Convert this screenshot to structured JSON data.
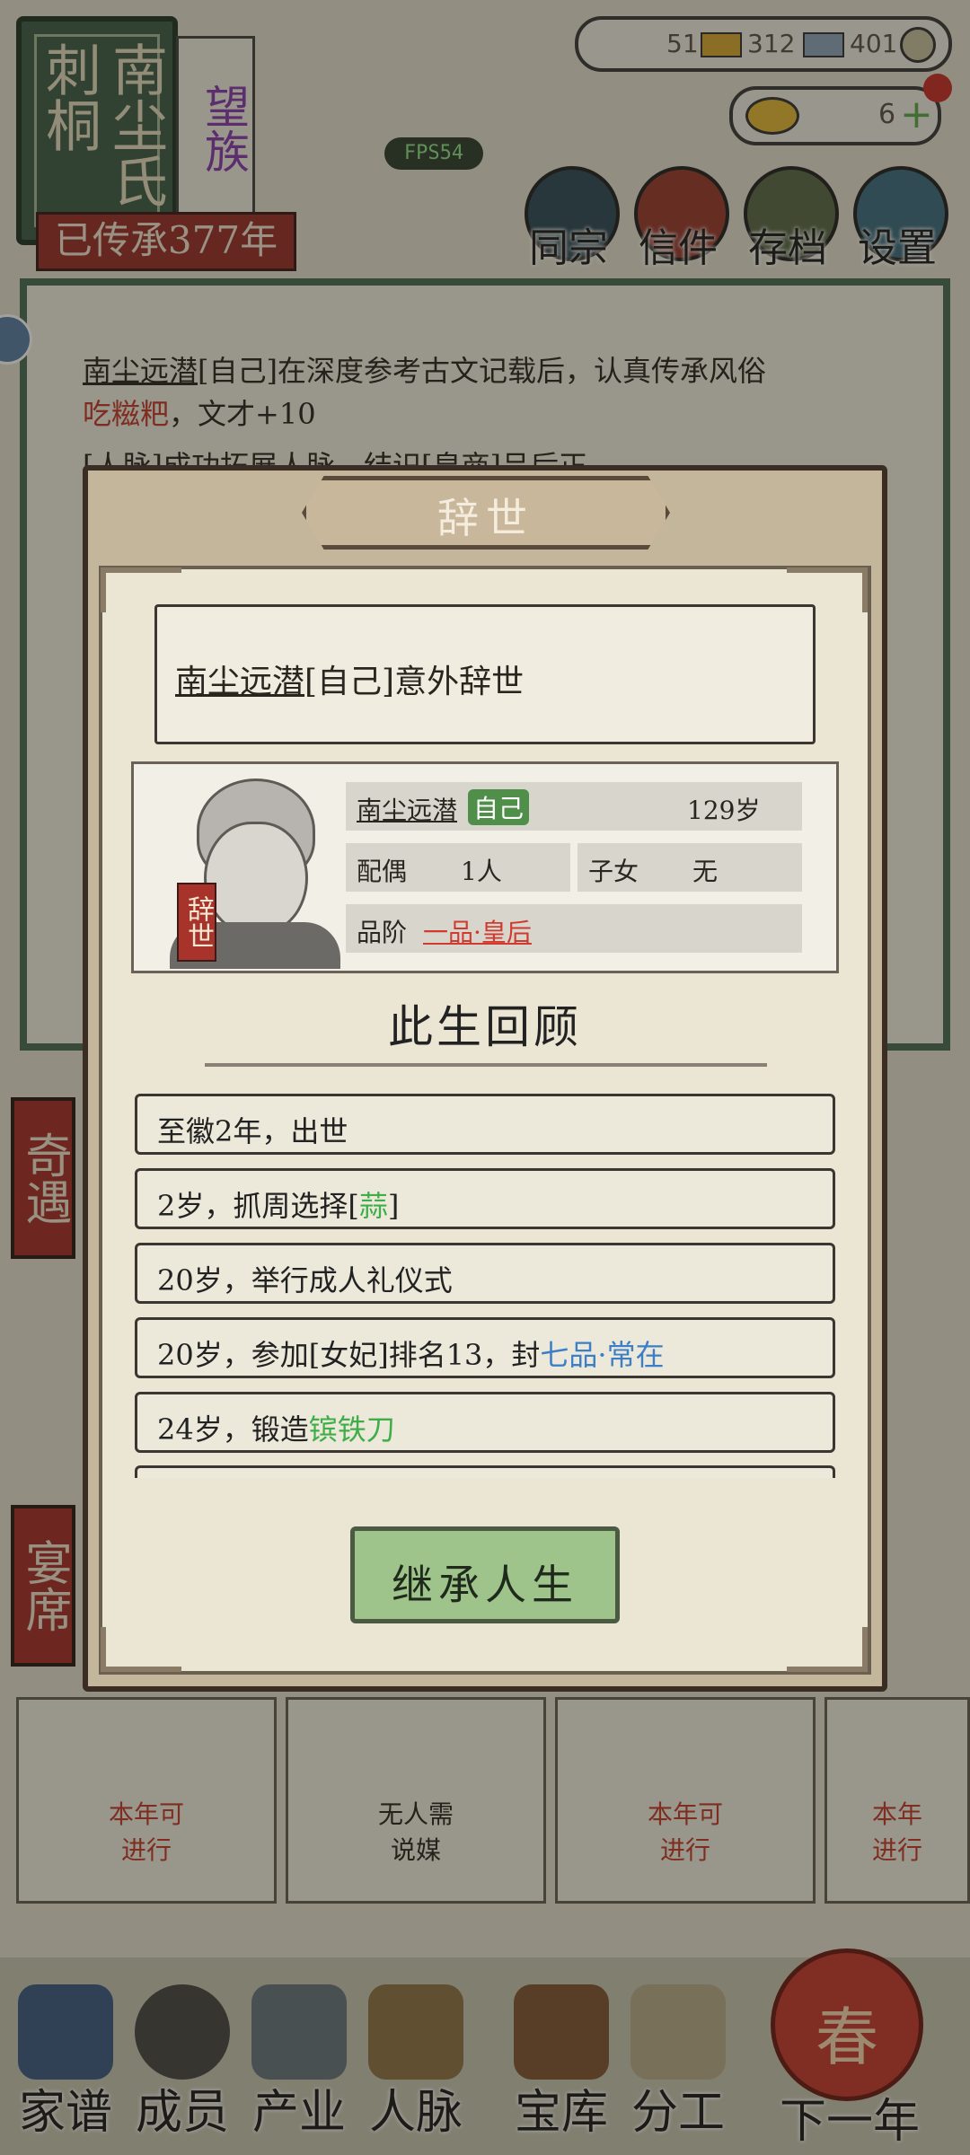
{
  "header": {
    "family_name": "南尘氏",
    "family_courtesy": "刺桐",
    "clan_rank": "望族",
    "inheritance": "已传承377年",
    "fps": "FPS54",
    "resources": {
      "copper": "51",
      "gold_ingots": "312",
      "silver_ingots": "401"
    },
    "gold_count": "6",
    "menu": [
      "同宗",
      "信件",
      "存档",
      "设置"
    ]
  },
  "log": {
    "line1_name": "南尘远潜",
    "line1_rest": "[自己]在深度参考古文记载后，认真传承风俗",
    "line1_custom": "吃糍粑",
    "line1_end": "，文才+10",
    "line2": "[人脉]成功拓展人脉，结识[皇商]吕后正"
  },
  "side_tabs": [
    "奇遇",
    "宴席"
  ],
  "cards": [
    {
      "text1": "本年可",
      "text2": "进行"
    },
    {
      "text1": "无人需",
      "text2": "说媒"
    },
    {
      "text1": "本年可",
      "text2": "进行"
    },
    {
      "text1": "本年",
      "text2": "进行"
    }
  ],
  "dialog": {
    "title": "辞世",
    "event_name": "南尘远潜",
    "event_rest": "[自己]意外辞世",
    "death_tag": "辞世",
    "person": {
      "name": "南尘远潜",
      "self_label": "自己",
      "age": "129岁",
      "spouse_label": "配偶",
      "spouse_value": "1人",
      "children_label": "子女",
      "children_value": "无",
      "rank_label": "品阶",
      "rank_value": "一品·皇后"
    },
    "review_title": "此生回顾",
    "review": [
      {
        "text": "至徽2年，出世"
      },
      {
        "pre": "2岁，抓周选择[",
        "hl": "蒜",
        "post": "]"
      },
      {
        "text": "20岁，举行成人礼仪式"
      },
      {
        "pre": "20岁，参加[女妃]排名13，封",
        "hl": "七品·常在",
        "post": ""
      },
      {
        "pre": "24岁，锻造",
        "hl": "镔铁刀",
        "post": ""
      }
    ],
    "inherit_button": "继承人生"
  },
  "bottom_nav": [
    "家谱",
    "成员",
    "产业",
    "人脉",
    "宝库",
    "分工",
    "下一年"
  ],
  "next_year_badge": "春",
  "colors": {
    "accent_green": "#4f8f4a",
    "accent_red": "#a72f2a",
    "rank_red": "#d13a2e",
    "highlight_blue": "#3d7fc7"
  }
}
